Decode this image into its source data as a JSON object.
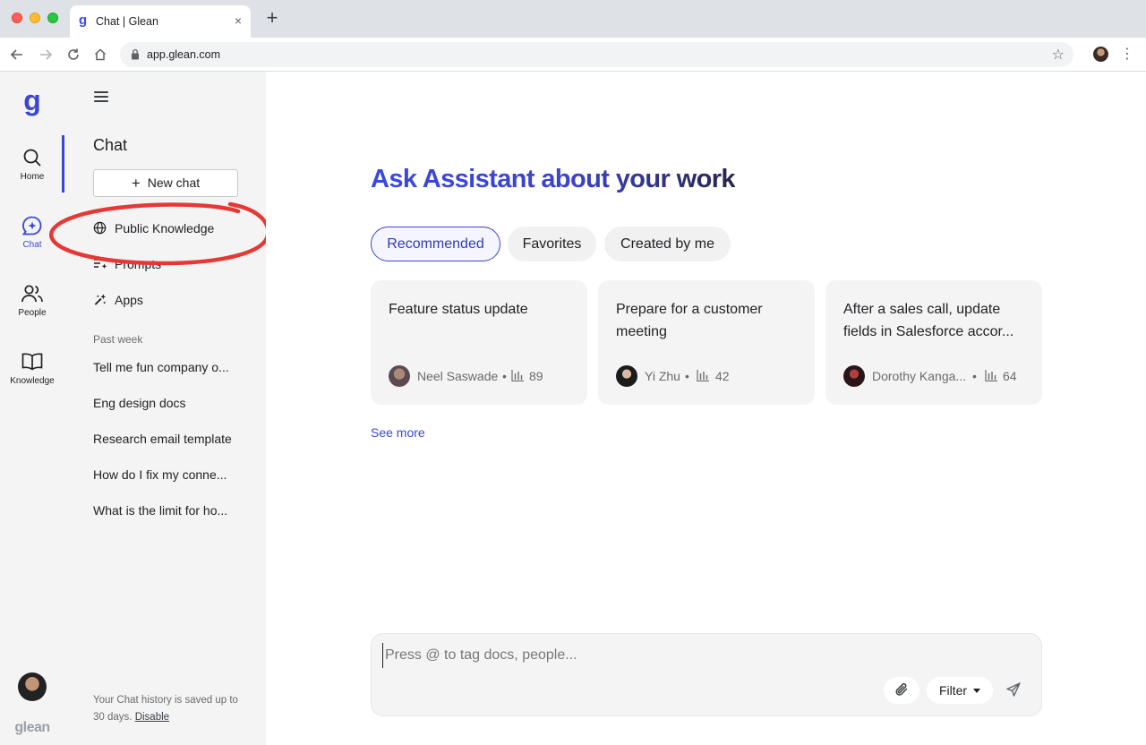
{
  "browser": {
    "tab_title": "Chat | Glean",
    "tab_favicon": "g",
    "tab_close": "×",
    "new_tab": "+",
    "url": "app.glean.com",
    "star_icon": "☆",
    "menu_icon": "⋮"
  },
  "rail": {
    "logo": "g",
    "items": [
      {
        "label": "Home",
        "icon": "search-icon"
      },
      {
        "label": "Chat",
        "icon": "chat-sparkle-icon",
        "active": true
      },
      {
        "label": "People",
        "icon": "people-icon"
      },
      {
        "label": "Knowledge",
        "icon": "book-icon"
      }
    ],
    "brand": "glean"
  },
  "sidebar": {
    "title": "Chat",
    "new_chat_label": "New chat",
    "nav": [
      {
        "label": "Public Knowledge",
        "icon": "globe-icon"
      },
      {
        "label": "Prompts",
        "icon": "prompts-icon"
      },
      {
        "label": "Apps",
        "icon": "apps-icon"
      }
    ],
    "section_label": "Past week",
    "history": [
      "Tell me fun company o...",
      "Eng design docs",
      "Research email template",
      "How do I fix my conne...",
      "What is the limit for ho..."
    ],
    "footer_text": "Your Chat history is saved up to 30 days.",
    "footer_link": "Disable"
  },
  "main": {
    "heading": "Ask Assistant about your work",
    "tabs": [
      {
        "label": "Recommended",
        "active": true
      },
      {
        "label": "Favorites"
      },
      {
        "label": "Created by me"
      }
    ],
    "cards": [
      {
        "title": "Feature status update",
        "author": "Neel Saswade",
        "count": "89"
      },
      {
        "title": "Prepare for a customer meeting",
        "author": "Yi Zhu",
        "count": "42"
      },
      {
        "title": "After a sales call, update fields in Salesforce accor...",
        "author": "Dorothy Kanga...",
        "count": "64"
      }
    ],
    "meta_separator": "•",
    "see_more": "See more",
    "composer": {
      "placeholder": "Press @ to tag docs, people...",
      "value": "",
      "filter_label": "Filter"
    }
  },
  "colors": {
    "accent": "#3a47d5",
    "annotation": "#e53935",
    "panel_bg": "#f4f4f4"
  }
}
